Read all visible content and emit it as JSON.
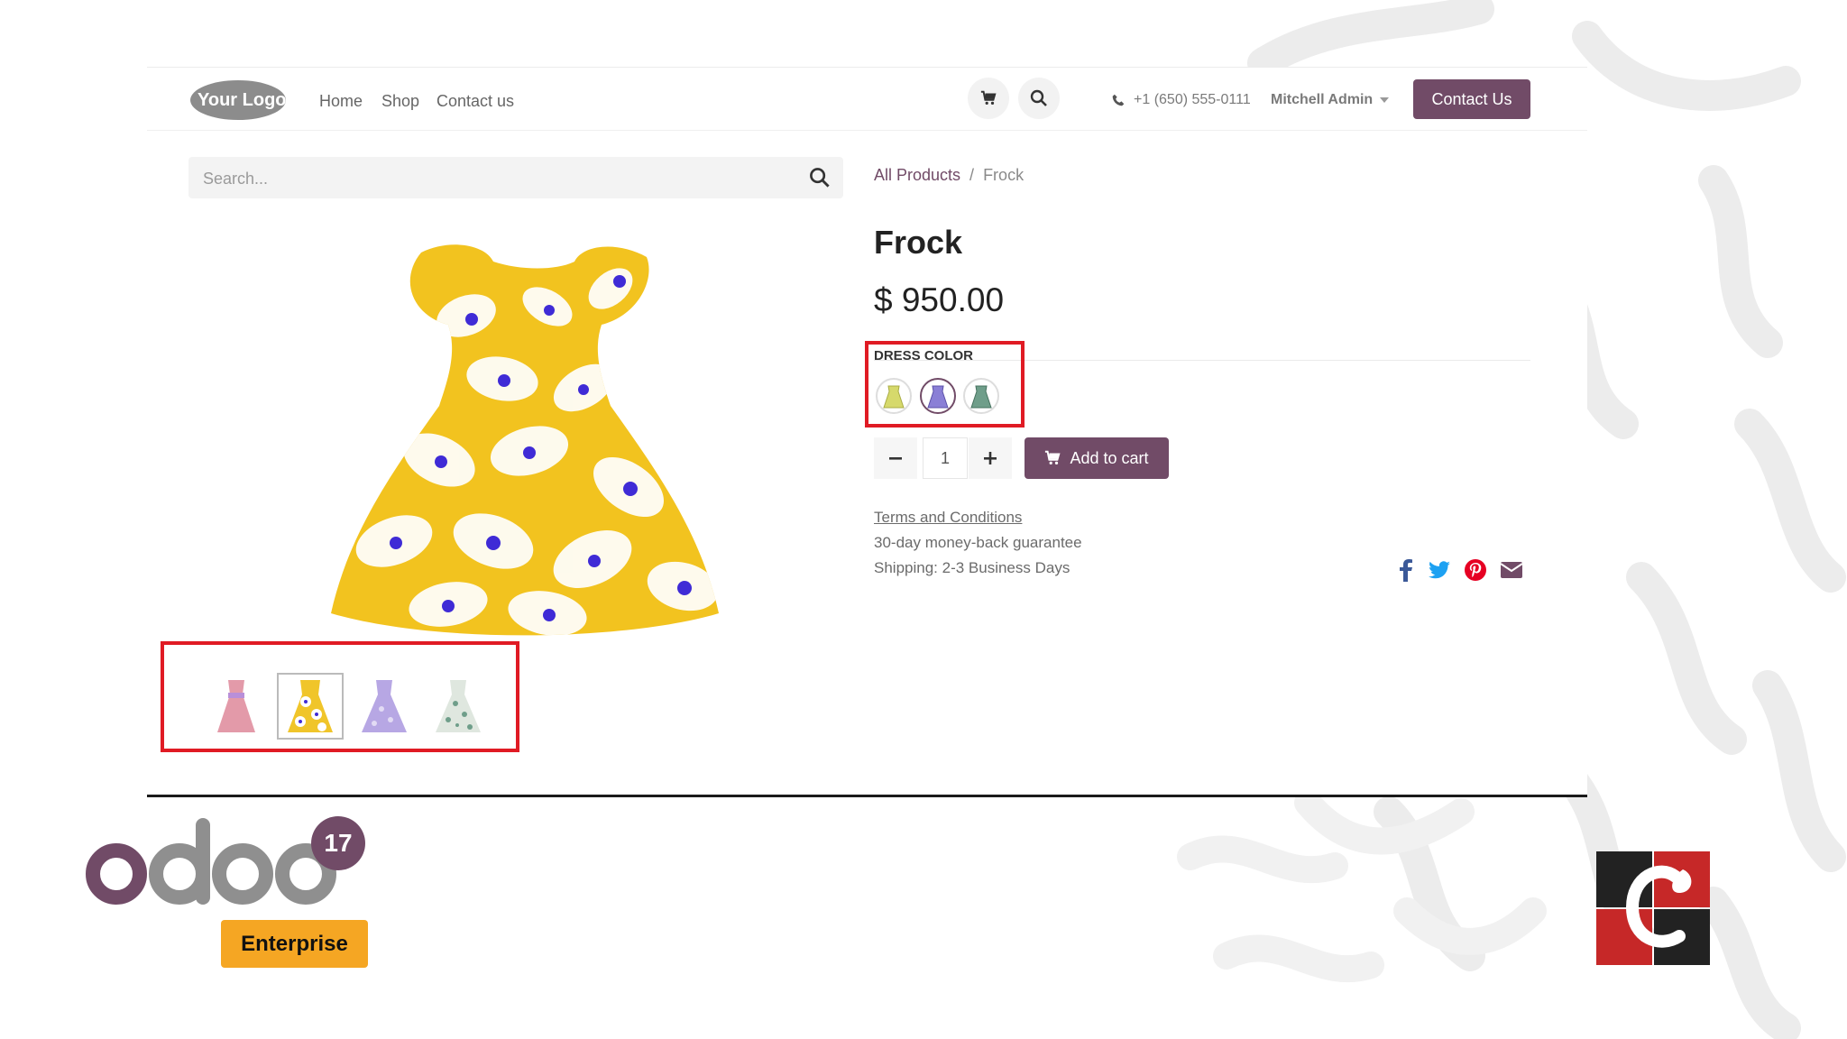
{
  "header": {
    "logo_text": "Your Logo",
    "nav": [
      "Home",
      "Shop",
      "Contact us"
    ],
    "phone": "+1 (650) 555-0111",
    "user": "Mitchell Admin",
    "contact_button": "Contact Us"
  },
  "search": {
    "placeholder": "Search..."
  },
  "breadcrumb": {
    "root": "All Products",
    "separator": "/",
    "current": "Frock"
  },
  "product": {
    "name": "Frock",
    "price": "$ 950.00",
    "attribute_label": "DRESS COLOR",
    "swatches": [
      {
        "name": "yellow-green",
        "color": "#d6d96b",
        "selected": false
      },
      {
        "name": "purple",
        "color": "#8a7fd6",
        "selected": true
      },
      {
        "name": "teal",
        "color": "#6f9e8a",
        "selected": false
      }
    ],
    "quantity": "1",
    "add_to_cart": "Add to cart",
    "terms": "Terms and Conditions",
    "guarantee": "30-day money-back guarantee",
    "shipping": "Shipping: 2-3 Business Days"
  },
  "thumbnails": [
    {
      "name": "pink-dress",
      "color": "#e39aa9",
      "selected": false
    },
    {
      "name": "yellow-floral-dress",
      "color": "#f0c52a",
      "selected": true
    },
    {
      "name": "lavender-dress",
      "color": "#b7a7e4",
      "selected": false
    },
    {
      "name": "green-print-dress",
      "color": "#9fb6a8",
      "selected": false
    }
  ],
  "footer": {
    "odoo_text": "odoo",
    "version": "17",
    "edition": "Enterprise"
  },
  "colors": {
    "accent": "#714b67",
    "highlight": "#e01b24",
    "enterprise": "#f5a623"
  }
}
